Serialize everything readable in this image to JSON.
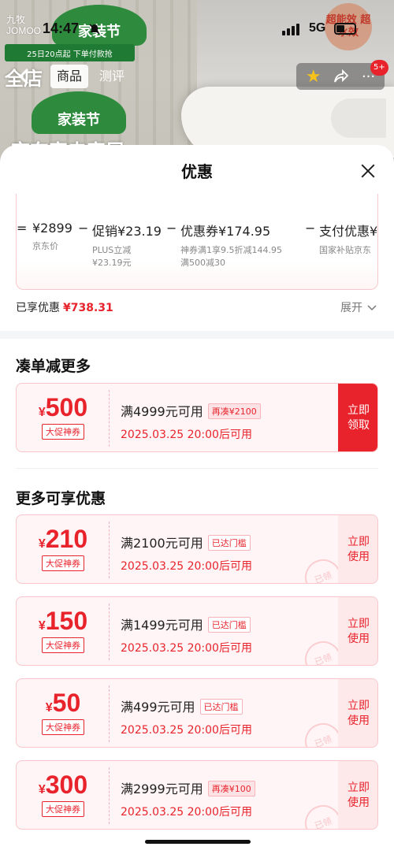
{
  "background": {
    "brand_logo": "九牧\nJOMOO",
    "festival_badge": "家装节",
    "banner_text": "25日20点起 下单付款抢",
    "big_title": "全店",
    "festival_badge2": "家装节",
    "subtitle": "京东家电家居",
    "seal_text": "超能效 超水效"
  },
  "status_bar": {
    "time": "14:47",
    "network": "5G"
  },
  "nav": {
    "back_icon": "chevron-left-icon",
    "tabs": [
      {
        "label": "商品",
        "active": true
      },
      {
        "label": "测评",
        "active": false
      }
    ],
    "notification_count": "5+"
  },
  "sheet": {
    "title": "优惠",
    "breakdown": {
      "cut_text": "- - -",
      "items": [
        {
          "main": "¥2899",
          "sub": [
            "京东价"
          ]
        },
        {
          "main": "促销¥23.19",
          "sub": [
            "PLUS立减",
            "¥23.19元"
          ]
        },
        {
          "main": "优惠券¥174.95",
          "sub": [
            "神券满1享9.5折减144.95",
            "满500减30"
          ]
        },
        {
          "main": "支付优惠¥",
          "sub": [
            "国家补贴京东"
          ]
        }
      ]
    },
    "enjoyed_label": "已享优惠",
    "enjoyed_amount": "¥738.31",
    "expand_label": "展开",
    "section1_title": "凑单减更多",
    "section2_title": "更多可享优惠",
    "coupons": [
      {
        "yen": "¥",
        "amount": "500",
        "tag": "大促神券",
        "condition_num": "4999",
        "condition_text": "满4999元可用",
        "badge": "再凑¥2100",
        "badge_type": "more",
        "time": "2025.03.25 20:00后可用",
        "action": "立即\n领取",
        "action_type": "primary"
      },
      {
        "yen": "¥",
        "amount": "210",
        "tag": "大促神券",
        "condition_text": "满2100元可用",
        "badge": "已达门槛",
        "badge_type": "reached",
        "time": "2025.03.25 20:00后可用",
        "action": "立即\n使用",
        "action_type": "secondary",
        "stamp": "已领"
      },
      {
        "yen": "¥",
        "amount": "150",
        "tag": "大促神券",
        "condition_text": "满1499元可用",
        "badge": "已达门槛",
        "badge_type": "reached",
        "time": "2025.03.25 20:00后可用",
        "action": "立即\n使用",
        "action_type": "secondary",
        "stamp": "已领"
      },
      {
        "yen": "¥",
        "amount": "50",
        "tag": "大促神券",
        "condition_text": "满499元可用",
        "badge": "已达门槛",
        "badge_type": "reached",
        "time": "2025.03.25 20:00后可用",
        "action": "立即\n使用",
        "action_type": "secondary",
        "stamp": "已领"
      },
      {
        "yen": "¥",
        "amount": "300",
        "tag": "大促神券",
        "condition_text": "满2999元可用",
        "badge": "再凑¥100",
        "badge_type": "more",
        "time": "2025.03.25 20:00后可用",
        "action": "立即\n使用",
        "action_type": "secondary",
        "stamp": "已领"
      }
    ]
  },
  "colors": {
    "accent": "#e8232c",
    "brand_green": "#2e8b3e"
  }
}
